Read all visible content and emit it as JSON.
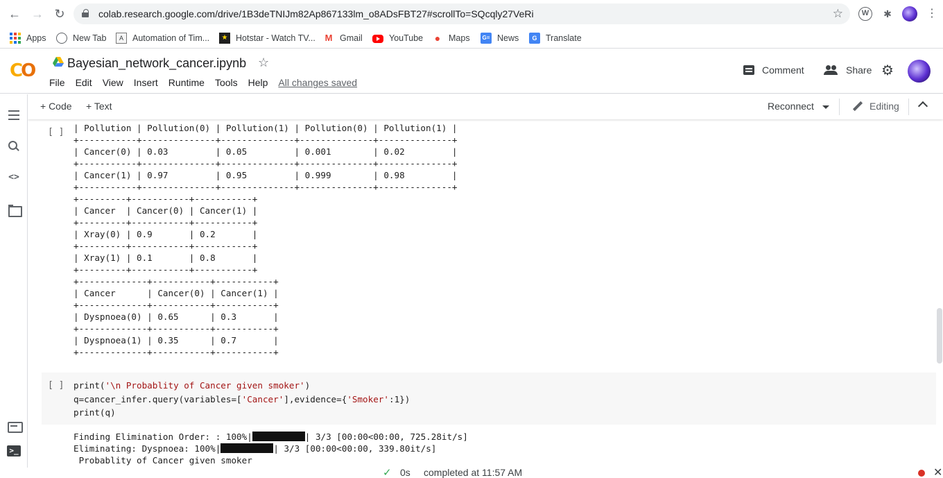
{
  "browser": {
    "url": "colab.research.google.com/drive/1B3deTNIJm82Ap867133lm_o8ADsFBT27#scrollTo=SQcqly27VeRi",
    "bookmarks": [
      {
        "label": "Apps",
        "icon": "apps-grid-icon"
      },
      {
        "label": "New Tab",
        "icon": "globe-icon"
      },
      {
        "label": "Automation of Tim...",
        "icon": "automation-icon"
      },
      {
        "label": "Hotstar - Watch TV...",
        "icon": "hotstar-icon"
      },
      {
        "label": "Gmail",
        "icon": "gmail-icon"
      },
      {
        "label": "YouTube",
        "icon": "youtube-icon"
      },
      {
        "label": "Maps",
        "icon": "maps-icon"
      },
      {
        "label": "News",
        "icon": "news-icon"
      },
      {
        "label": "Translate",
        "icon": "translate-icon"
      }
    ]
  },
  "notebook": {
    "title": "Bayesian_network_cancer.ipynb",
    "menu": [
      "File",
      "Edit",
      "View",
      "Insert",
      "Runtime",
      "Tools",
      "Help"
    ],
    "saved_status": "All changes saved",
    "comment_label": "Comment",
    "share_label": "Share"
  },
  "toolbar": {
    "add_code": "+ Code",
    "add_text": "+ Text",
    "reconnect": "Reconnect",
    "editing": "Editing"
  },
  "cells": {
    "output_cell_run": "[ ]",
    "output_text": "| Pollution | Pollution(0) | Pollution(1) | Pollution(0) | Pollution(1) |\n+-----------+--------------+--------------+--------------+--------------+\n| Cancer(0) | 0.03         | 0.05         | 0.001        | 0.02         |\n+-----------+--------------+--------------+--------------+--------------+\n| Cancer(1) | 0.97         | 0.95         | 0.999        | 0.98         |\n+-----------+--------------+--------------+--------------+--------------+\n+---------+-----------+-----------+\n| Cancer  | Cancer(0) | Cancer(1) |\n+---------+-----------+-----------+\n| Xray(0) | 0.9       | 0.2       |\n+---------+-----------+-----------+\n| Xray(1) | 0.1       | 0.8       |\n+---------+-----------+-----------+\n+-------------+-----------+-----------+\n| Cancer      | Cancer(0) | Cancer(1) |\n+-------------+-----------+-----------+\n| Dyspnoea(0) | 0.65      | 0.3       |\n+-------------+-----------+-----------+\n| Dyspnoea(1) | 0.35      | 0.7       |\n+-------------+-----------+-----------+",
    "code_cell_run": "[ ]",
    "code_line1_fn": "print(",
    "code_line1_str": "'\\n Probablity of Cancer given smoker'",
    "code_line1_end": ")",
    "code_line2_a": "q=cancer_infer.query(variables=[",
    "code_line2_str1": "'Cancer'",
    "code_line2_b": "],evidence={",
    "code_line2_str2": "'Smoker'",
    "code_line2_c": ":1})",
    "code_line3": "print(q)",
    "out_line1_a": "Finding Elimination Order: : 100%|",
    "out_line1_b": "| 3/3 [00:00<00:00, 725.28it/s]",
    "out_line1_progress": 1.0,
    "out_line2_a": "Eliminating: Dyspnoea: 100%|",
    "out_line2_b": "| 3/3 [00:00<00:00, 339.80it/s]",
    "out_line2_progress": 1.0,
    "out_line3": " Probablity of Cancer given smoker"
  },
  "status": {
    "duration": "0s",
    "message": "completed at 11:57 AM"
  },
  "colors": {
    "accent_orange": "#f9ab00",
    "string_red": "#a31515",
    "check_green": "#34a853",
    "status_red": "#d93025"
  }
}
